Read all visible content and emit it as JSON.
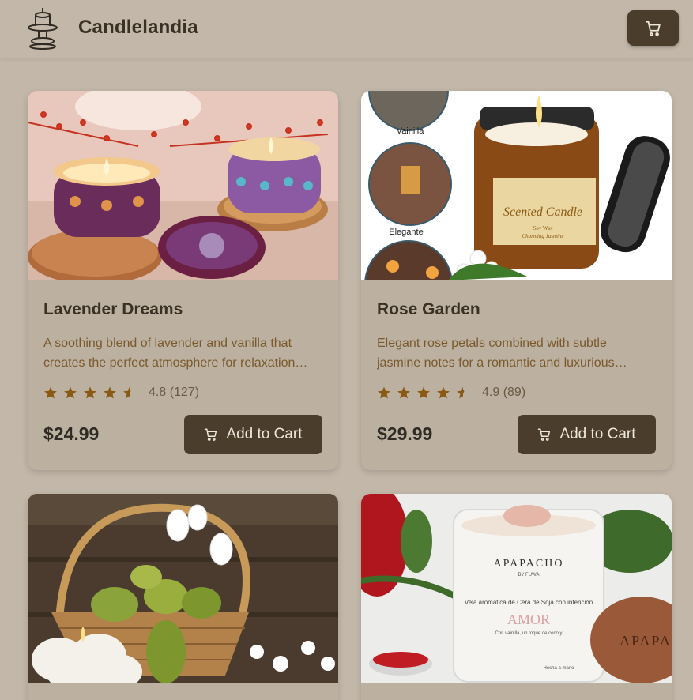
{
  "header": {
    "brand": "Candlelandia",
    "logo_icon": "candle-logo-icon",
    "cart_icon": "cart-icon"
  },
  "colors": {
    "background": "#c2b7a9",
    "card": "#bcb0a1",
    "button": "#4a3d2b",
    "star": "#8a5a14",
    "description": "#7a5a2c"
  },
  "products": [
    {
      "name": "Lavender Dreams",
      "description": "A soothing blend of lavender and vanilla that creates the perfect atmosphere for relaxation and calm evenings.",
      "rating_value": 4.8,
      "rating_text": "4.8 (127)",
      "price": "$24.99",
      "button_label": "Add to Cart"
    },
    {
      "name": "Rose Garden",
      "description": "Elegant rose petals combined with subtle jasmine notes for a romantic and luxurious experience.",
      "rating_value": 4.9,
      "rating_text": "4.9 (89)",
      "price": "$29.99",
      "button_label": "Add to Cart",
      "image_labels": {
        "vainilla": "Vainilla",
        "elegante": "Elegante",
        "jar_label": "Scented Candle",
        "jar_sub1": "Soy Wax",
        "jar_sub2": "Charming Jasmine"
      }
    },
    {
      "name": "",
      "description": "",
      "price": ""
    },
    {
      "name": "",
      "description": "",
      "price": "",
      "image_labels": {
        "brand": "APAPACHO",
        "sub": "BY FUWA",
        "line": "Vela aromática de Cera de Soja con intención",
        "amor": "AMOR",
        "small1": "Con vainilla, un toque de coco y",
        "small2": "Hecha a mano",
        "lid": "APAPA"
      }
    }
  ]
}
